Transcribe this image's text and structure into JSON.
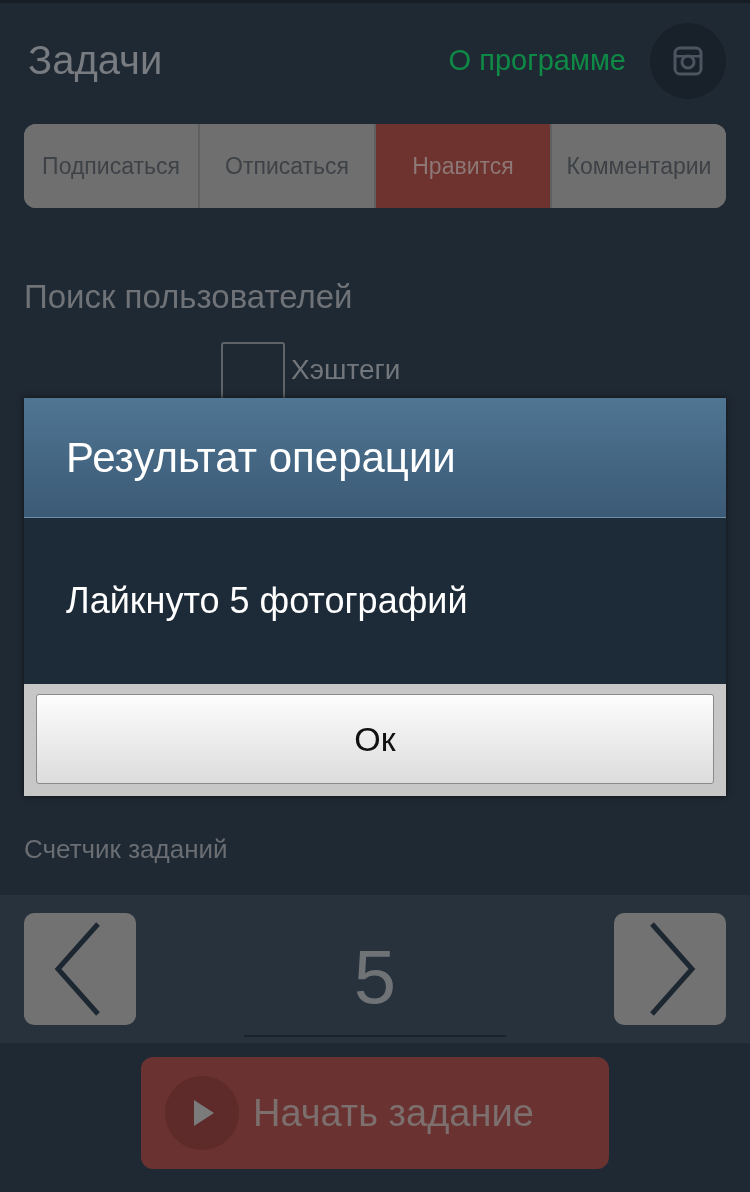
{
  "header": {
    "title": "Задачи",
    "about_link": "О программе"
  },
  "tabs": [
    {
      "label": "Подписаться",
      "selected": false
    },
    {
      "label": "Отписаться",
      "selected": false
    },
    {
      "label": "Нравится",
      "selected": true
    },
    {
      "label": "Комментарии",
      "selected": false
    }
  ],
  "search_section": {
    "title": "Поиск пользователей",
    "hashtags": {
      "label": "Хэштеги",
      "checked": false
    }
  },
  "dialog": {
    "title": "Результат операции",
    "message": "Лайкнуто 5 фотографий",
    "button": "Ок"
  },
  "counter": {
    "label": "Счетчик заданий",
    "value": "5"
  },
  "start_button": "Начать задание"
}
